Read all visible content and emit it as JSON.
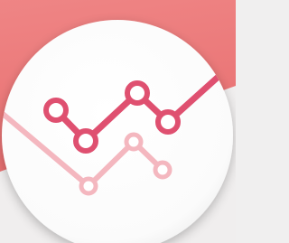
{
  "icon": {
    "name": "line-chart-app-icon",
    "colors": {
      "background_top": "#ee7c7c",
      "background_bottom": "#f0eeee",
      "circle_face": "#ffffff",
      "primary_line": "#e0506e",
      "secondary_line": "#f3b6be"
    },
    "primary_series_points": 5,
    "secondary_series_points": 4
  }
}
